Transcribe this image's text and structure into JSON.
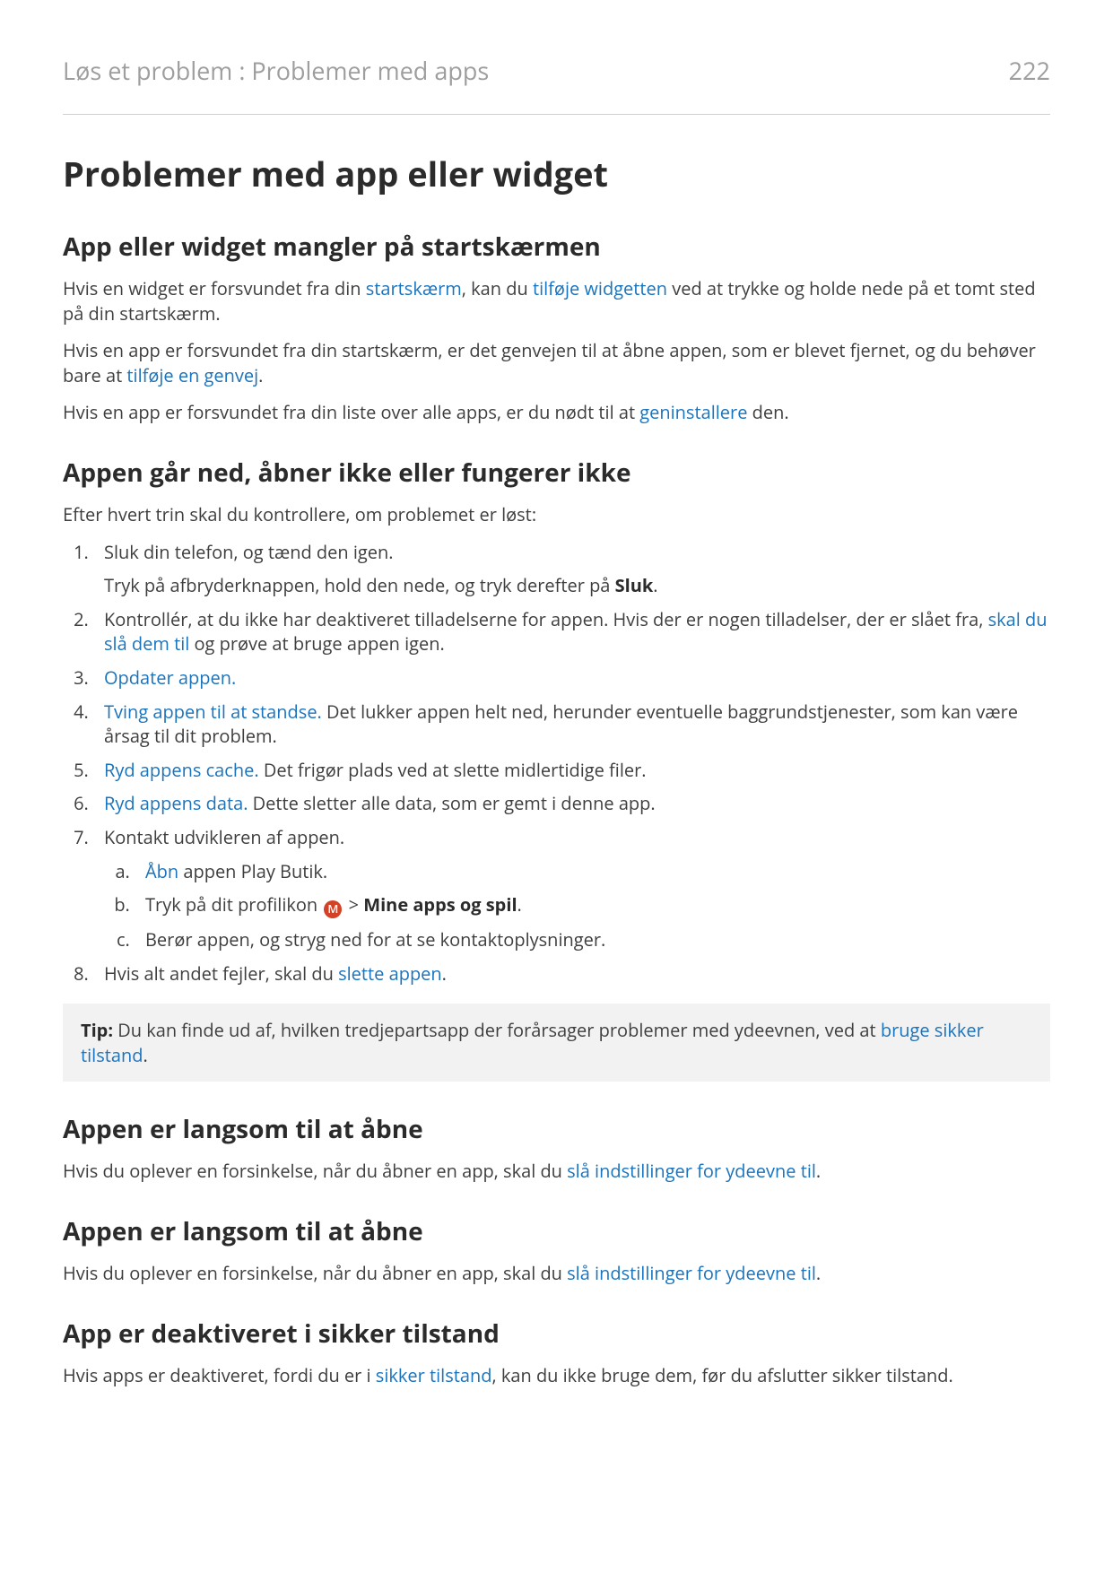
{
  "header": {
    "breadcrumb": "Løs et problem : Problemer med apps",
    "page_number": "222"
  },
  "title": "Problemer med app eller widget",
  "s1": {
    "heading": "App eller widget mangler på startskærmen",
    "p1a": "Hvis en widget er forsvundet fra din ",
    "p1_link1": "startskærm",
    "p1b": ", kan du ",
    "p1_link2": "tilføje widgetten",
    "p1c": " ved at trykke og holde nede på et tomt sted på din startskærm.",
    "p2a": "Hvis en app er forsvundet fra din startskærm, er det genvejen til at åbne appen, som er blevet fjernet, og du behøver bare at ",
    "p2_link": "tilføje en genvej",
    "p2b": ".",
    "p3a": "Hvis en app er forsvundet fra din liste over alle apps, er du nødt til at ",
    "p3_link": "geninstallere",
    "p3b": " den."
  },
  "s2": {
    "heading": "Appen går ned, åbner ikke eller fungerer ikke",
    "intro": "Efter hvert trin skal du kontrollere, om problemet er løst:",
    "step1": "Sluk din telefon, og tænd den igen.",
    "step1_sub_a": "Tryk på afbryderknappen, hold den nede, og tryk derefter på ",
    "step1_sub_bold": "Sluk",
    "step1_sub_b": ".",
    "step2a": "Kontrollér, at du ikke har deaktiveret tilladelserne for appen. Hvis der er nogen tilladelser, der er slået fra, ",
    "step2_link": "skal du slå dem til",
    "step2b": " og prøve at bruge appen igen.",
    "step3_link": "Opdater appen.",
    "step4_link": "Tving appen til at standse.",
    "step4_rest": " Det lukker appen helt ned, herunder eventuelle baggrundstjenester, som kan være årsag til dit problem.",
    "step5_link": "Ryd appens cache.",
    "step5_rest": " Det frigør plads ved at slette midlertidige filer.",
    "step6_link": "Ryd appens data.",
    "step6_rest": " Dette sletter alle data, som er gemt i denne app.",
    "step7": "Kontakt udvikleren af appen.",
    "step7a_link": "Åbn",
    "step7a_rest": " appen Play Butik.",
    "step7b_a": "Tryk på dit profilikon ",
    "step7b_icon_letter": "M",
    "step7b_gt": " > ",
    "step7b_bold": "Mine apps og spil",
    "step7b_end": ".",
    "step7c": "Berør appen, og stryg ned for at se kontaktoplysninger.",
    "step8a": "Hvis alt andet fejler, skal du ",
    "step8_link": "slette appen",
    "step8b": "."
  },
  "tip": {
    "label": "Tip:",
    "text_a": " Du kan finde ud af, hvilken tredjepartsapp der forårsager problemer med ydeevnen, ved at ",
    "link": "bruge sikker tilstand",
    "text_b": "."
  },
  "s3": {
    "heading": "Appen er langsom til at åbne",
    "p_a": "Hvis du oplever en forsinkelse, når du åbner en app, skal du ",
    "p_link": "slå indstillinger for ydeevne til",
    "p_b": "."
  },
  "s4": {
    "heading": "Appen er langsom til at åbne",
    "p_a": "Hvis du oplever en forsinkelse, når du åbner en app, skal du ",
    "p_link": "slå indstillinger for ydeevne til",
    "p_b": "."
  },
  "s5": {
    "heading": "App er deaktiveret i sikker tilstand",
    "p_a": "Hvis apps er deaktiveret, fordi du er i ",
    "p_link": "sikker tilstand",
    "p_b": ", kan du ikke bruge dem, før du afslutter sikker tilstand."
  }
}
